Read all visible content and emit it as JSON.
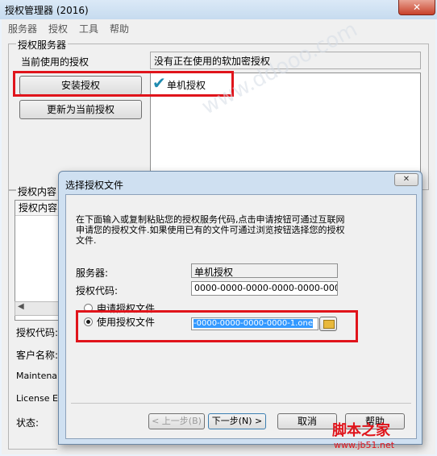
{
  "window": {
    "title": "授权管理器 (2016)",
    "close_glyph": "✕"
  },
  "menu": [
    "服务器",
    "授权",
    "工具",
    "帮助"
  ],
  "license_server": {
    "group_label": "授权服务器",
    "current_label": "当前使用的授权",
    "current_value": "没有正在使用的软加密授权",
    "install_button": "安装授权",
    "update_button": "更新为当前授权",
    "list_items": [
      {
        "label": "单机授权",
        "checked": true
      }
    ]
  },
  "license_content": {
    "group_label": "授权内容",
    "column_header": "授权内容",
    "fields": [
      "授权代码:",
      "客户名称:",
      "Maintenance",
      "License Ex",
      "状态:"
    ]
  },
  "dialog": {
    "title": "选择授权文件",
    "description": "在下面输入或复制粘贴您的授权服务代码,点击申请按钮可通过互联网申请您的授权文件.如果使用已有的文件可通过浏览按钮选择您的授权文件.",
    "server_label": "服务器:",
    "server_value": "单机授权",
    "code_label": "授权代码:",
    "code_value": "0000-0000-0000-0000-0000-0000",
    "radio_apply": "申请授权文件",
    "radio_use": "使用授权文件",
    "selected_radio": "使用授权文件",
    "file_value": "-0000-0000-0000-0000-1.one",
    "buttons": {
      "back": "< 上一步(B)",
      "next": "下一步(N) >",
      "cancel": "取消",
      "help": "帮助"
    }
  },
  "watermark": {
    "logo": "脚本之家",
    "url": "www.jb51.net"
  },
  "colors": {
    "highlight_red": "#e0141b",
    "selection_blue": "#3399ff"
  }
}
